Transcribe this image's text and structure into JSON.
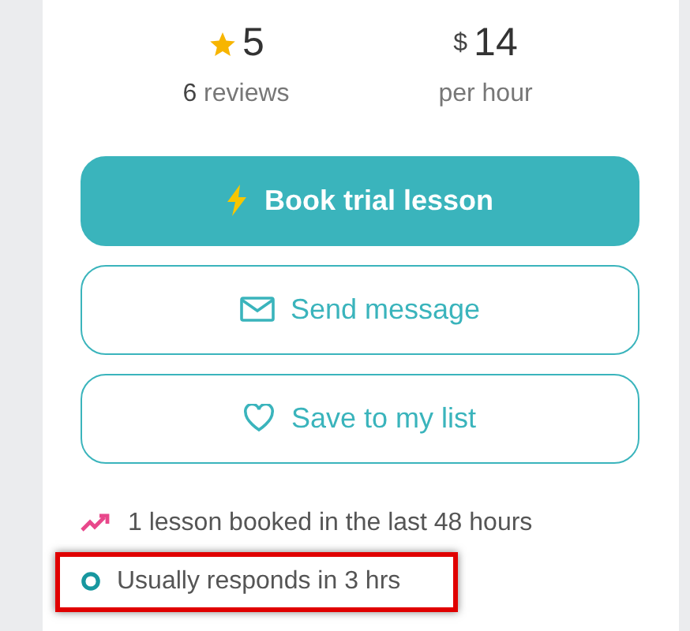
{
  "stats": [
    {
      "kind": "rating",
      "value": "5",
      "count": "6",
      "label": "reviews"
    },
    {
      "kind": "price",
      "currency": "$",
      "value": "14",
      "label": "per hour"
    }
  ],
  "buttons": [
    {
      "kind": "primary",
      "label": "Book trial lesson"
    },
    {
      "kind": "outline",
      "label": "Send message"
    },
    {
      "kind": "outline",
      "label": "Save to my list"
    }
  ],
  "facts": [
    {
      "text": "1 lesson booked in the last 48 hours",
      "highlighted": false
    },
    {
      "text": "Usually responds in 3 hrs",
      "highlighted": true
    }
  ]
}
